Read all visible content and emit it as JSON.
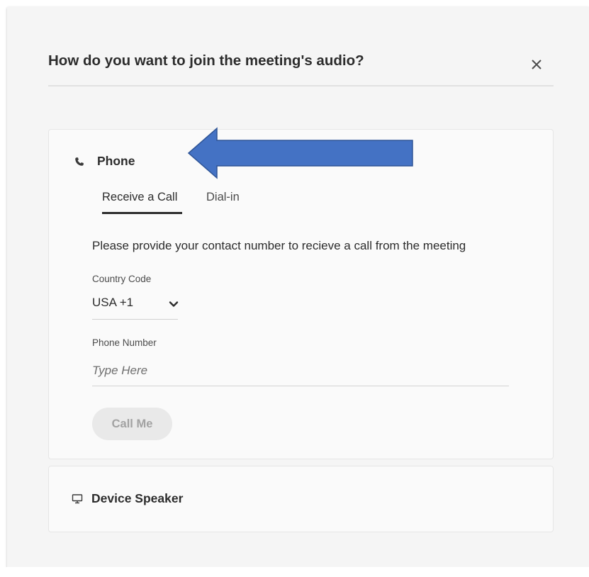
{
  "dialog": {
    "title": "How do you want to join the meeting's audio?",
    "close_icon": "close-icon"
  },
  "phone_section": {
    "icon": "phone-icon",
    "title": "Phone",
    "tabs": [
      {
        "label": "Receive a Call",
        "active": true
      },
      {
        "label": "Dial-in",
        "active": false
      }
    ],
    "instruction": "Please provide your contact number to recieve a call from the meeting",
    "country_code": {
      "label": "Country Code",
      "value": "USA +1",
      "icon": "chevron-down-icon"
    },
    "phone_number": {
      "label": "Phone Number",
      "value": "",
      "placeholder": "Type Here"
    },
    "call_button": {
      "label": "Call Me",
      "enabled": false
    }
  },
  "device_section": {
    "icon": "monitor-icon",
    "title": "Device Speaker"
  },
  "annotation": {
    "type": "left-arrow",
    "color": "#4472c4",
    "stroke": "#2f5597"
  }
}
